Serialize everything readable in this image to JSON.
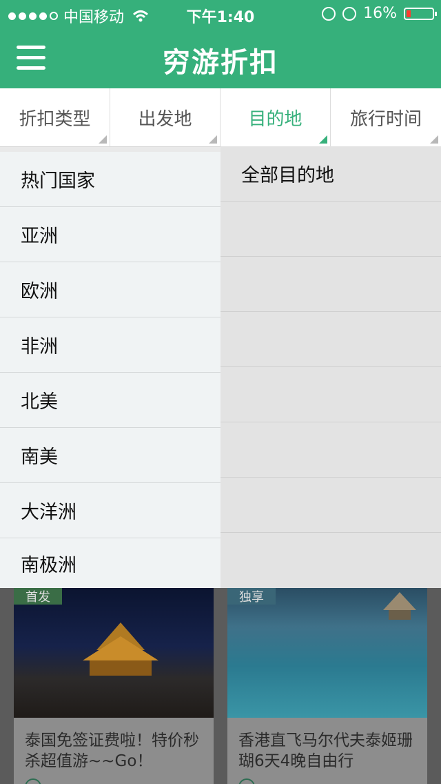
{
  "status_bar": {
    "carrier": "中国移动",
    "time": "下午1:40",
    "battery": "16%"
  },
  "nav": {
    "title": "穷游折扣"
  },
  "filters": [
    {
      "label": "折扣类型"
    },
    {
      "label": "出发地"
    },
    {
      "label": "目的地"
    },
    {
      "label": "旅行时间"
    }
  ],
  "regions": [
    {
      "label": "热门国家"
    },
    {
      "label": "亚洲"
    },
    {
      "label": "欧洲"
    },
    {
      "label": "非洲"
    },
    {
      "label": "北美"
    },
    {
      "label": "南美"
    },
    {
      "label": "大洋洲"
    },
    {
      "label": "南极洲"
    }
  ],
  "destinations": [
    {
      "label": "全部目的地"
    }
  ],
  "cards": [
    {
      "badge": "首发",
      "caption": "泰国免签证费啦！特价秒杀超值游~~Go！"
    },
    {
      "badge": "独享",
      "caption": "香港直飞马尔代夫泰姬珊瑚6天4晚自由行"
    }
  ],
  "colors": {
    "brand_green": "#36b07b",
    "active_tab": "#36b07b",
    "battery_low": "#ff3b30"
  }
}
